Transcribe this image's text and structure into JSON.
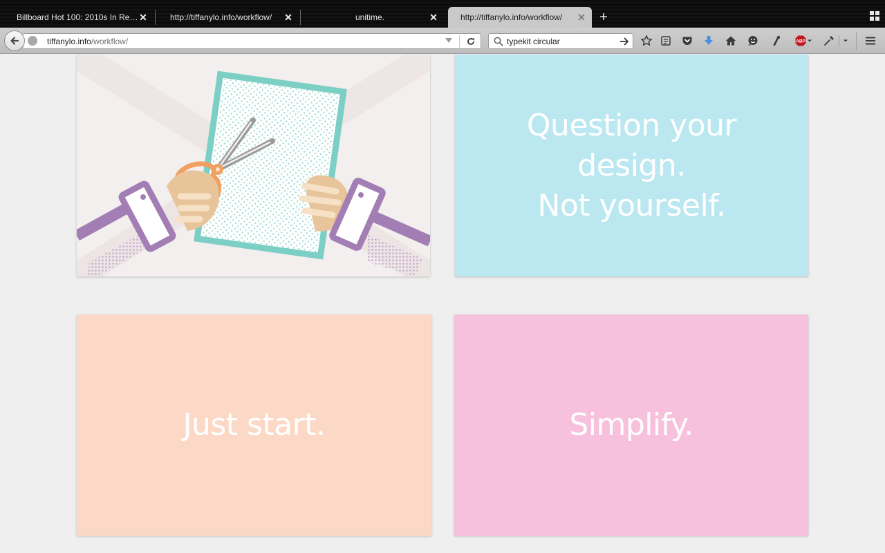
{
  "browser": {
    "tabs": [
      {
        "title": "Billboard Hot 100: 2010s In Revi...",
        "active": false
      },
      {
        "title": "http://tiffanylo.info/workflow/",
        "active": false
      },
      {
        "title": "unitime.",
        "active": false
      },
      {
        "title": "http://tiffanylo.info/workflow/",
        "active": true
      }
    ],
    "close_glyph": "✕",
    "new_tab_glyph": "+",
    "url": {
      "host": "tiffanylo.info",
      "path": "/workflow/"
    },
    "search": {
      "value": "typekit circular",
      "engine_icon": "search-icon"
    },
    "toolbar_icons": [
      "star-icon",
      "reading-list-icon",
      "pocket-icon",
      "download-icon",
      "home-icon",
      "smiley-icon",
      "extension-icon",
      "adblock-icon",
      "eyedropper-icon",
      "menu-icon"
    ],
    "adblock_label": "ABP"
  },
  "page": {
    "cards": [
      {
        "kind": "illustration",
        "subject": "hands cutting paper with scissors"
      },
      {
        "kind": "quote",
        "lines": [
          "Question your",
          "design.",
          "Not yourself."
        ],
        "bg": "#bbe8f0"
      },
      {
        "kind": "quote",
        "lines": [
          "Just start."
        ],
        "bg": "#fcd9c7"
      },
      {
        "kind": "quote",
        "lines": [
          "Simplify."
        ],
        "bg": "#f7c1dd"
      }
    ]
  },
  "colors": {
    "illustration_bg": "#f3efee",
    "paper_border": "#7ccfc4",
    "sleeve": "#a27eb4",
    "hand": "#e8c49a",
    "scissor_handle": "#f0a060",
    "scissor_blade": "#9a9a9a"
  }
}
